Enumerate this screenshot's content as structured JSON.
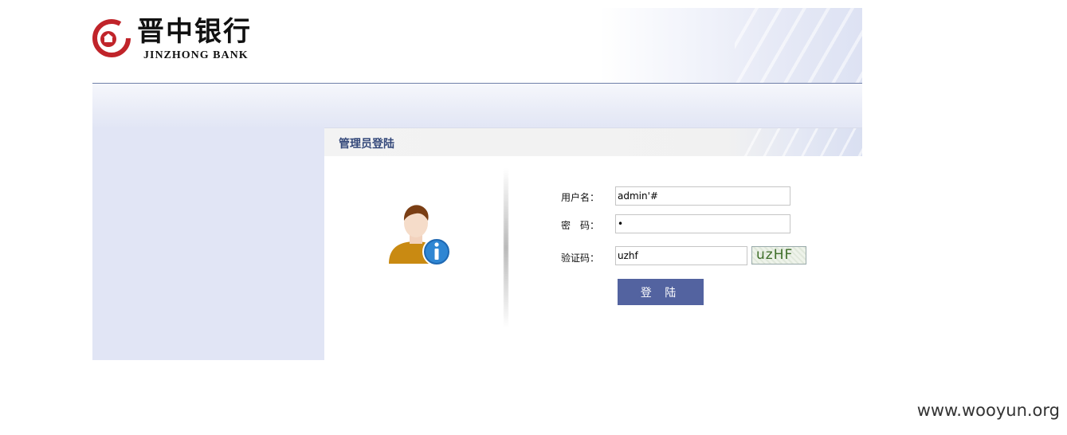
{
  "header": {
    "logo_cn": "晋中银行",
    "logo_en": "JINZHONG BANK",
    "logo_color": "#c0242a"
  },
  "login": {
    "title": "管理员登陆",
    "avatar_icon": "user-info-icon",
    "username_label": "用户名：",
    "username_value": "admin'#",
    "password_label": "密　码：",
    "password_value": "•",
    "captcha_label": "验证码：",
    "captcha_value": "uzhf",
    "captcha_image_text": "uzHF",
    "submit_label": "登 陆",
    "accent_color": "#5363a0"
  },
  "watermark": "www.wooyun.org"
}
